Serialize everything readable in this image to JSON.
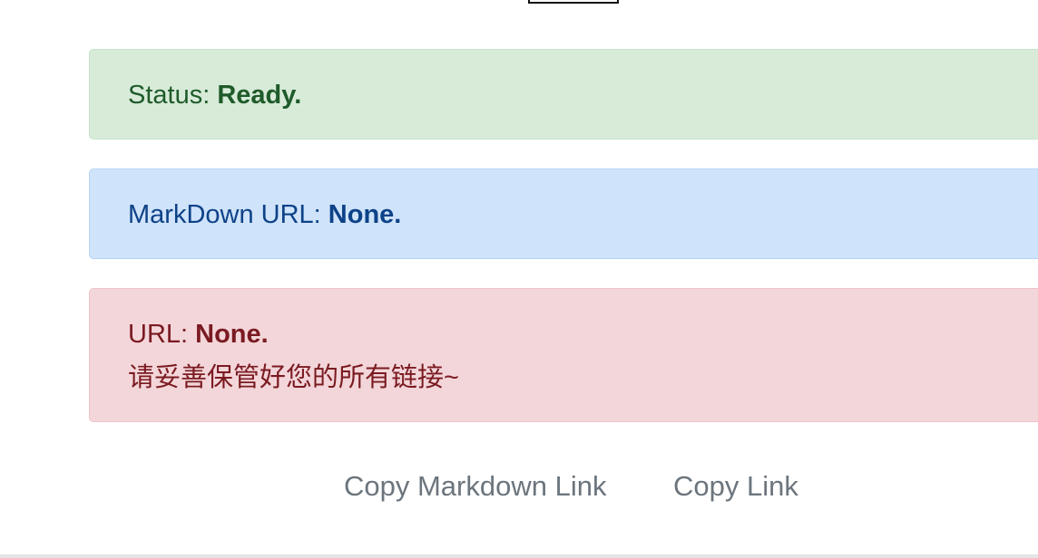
{
  "status_alert": {
    "label": "Status: ",
    "value": "Ready.",
    "color": "#1f5b2a"
  },
  "markdown_alert": {
    "label": "MarkDown URL: ",
    "value": "None.",
    "color": "#0d4288"
  },
  "url_alert": {
    "label": "URL: ",
    "value": "None.",
    "note": "请妥善保管好您的所有链接~",
    "color": "#7a1a21"
  },
  "buttons": {
    "copy_markdown": "Copy Markdown Link",
    "copy_link": "Copy Link"
  }
}
